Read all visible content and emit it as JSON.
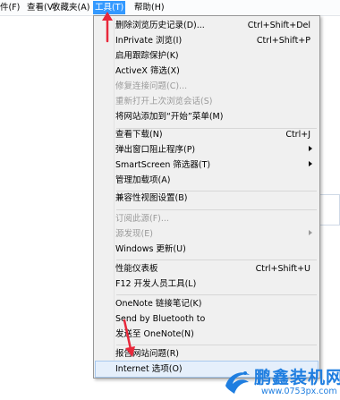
{
  "menubar": {
    "items": [
      {
        "label": "件(F)"
      },
      {
        "label": "查看(V)"
      },
      {
        "label": "收藏夹(A)"
      },
      {
        "label": "工具(T)"
      },
      {
        "label": "帮助(H)"
      }
    ]
  },
  "tools_menu": {
    "items": [
      {
        "label": "删除浏览历史记录(D)...",
        "shortcut": "Ctrl+Shift+Del"
      },
      {
        "label": "InPrivate 浏览(I)",
        "shortcut": "Ctrl+Shift+P"
      },
      {
        "label": "启用跟踪保护(K)"
      },
      {
        "label": "ActiveX 筛选(X)"
      },
      {
        "label": "修复连接问题(C)..."
      },
      {
        "label": "重新打开上次浏览会话(S)"
      },
      {
        "label": "将网站添加到“开始”菜单(M)"
      },
      {
        "label": "查看下载(N)",
        "shortcut": "Ctrl+J"
      },
      {
        "label": "弹出窗口阻止程序(P)"
      },
      {
        "label": "SmartScreen 筛选器(T)"
      },
      {
        "label": "管理加载项(A)"
      },
      {
        "label": "兼容性视图设置(B)"
      },
      {
        "label": "订阅此源(F)..."
      },
      {
        "label": "源发现(E)"
      },
      {
        "label": "Windows 更新(U)"
      },
      {
        "label": "性能仪表板",
        "shortcut": "Ctrl+Shift+U"
      },
      {
        "label": "F12 开发人员工具(L)"
      },
      {
        "label": "OneNote 链接笔记(K)"
      },
      {
        "label": "Send by Bluetooth to"
      },
      {
        "label": "发送至 OneNote(N)"
      },
      {
        "label": "报告网站问题(R)"
      },
      {
        "label": "Internet 选项(O)"
      }
    ]
  },
  "watermark": {
    "title": "鹏鑫装机网",
    "url": "www.0753px.com"
  },
  "colors": {
    "menu_highlight": "#3399ff",
    "popup_bg": "#f0f0f0",
    "disabled_text": "#9a9a9a",
    "annotation_arrow": "#e8283b",
    "watermark": "#1f7ee0"
  }
}
